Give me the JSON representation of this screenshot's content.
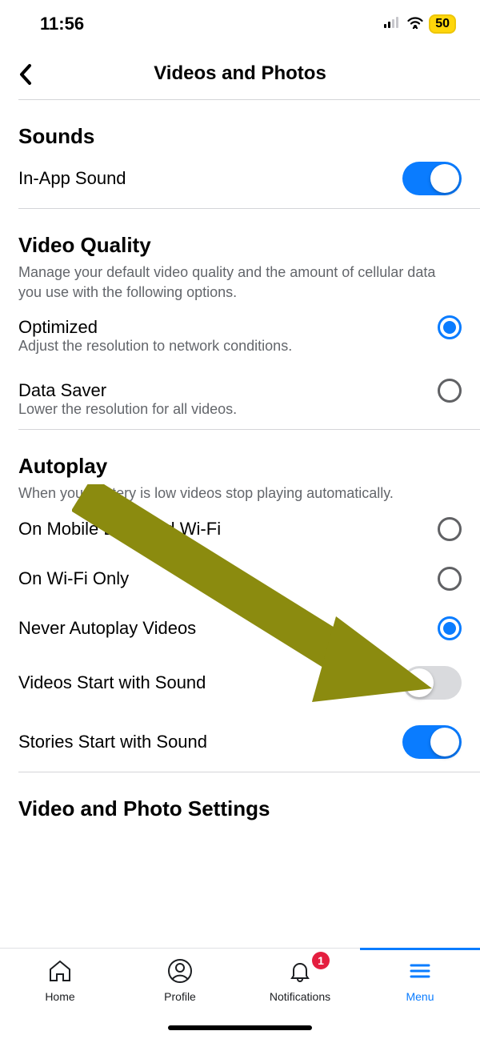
{
  "status": {
    "time": "11:56",
    "battery": "50"
  },
  "header": {
    "title": "Videos and Photos"
  },
  "sounds": {
    "title": "Sounds",
    "in_app_sound": {
      "label": "In-App Sound",
      "on": true
    }
  },
  "video_quality": {
    "title": "Video Quality",
    "subhead": "Manage your default video quality and the amount of cellular data you use with the following options.",
    "optimized": {
      "label": "Optimized",
      "desc": "Adjust the resolution to network conditions.",
      "selected": true
    },
    "data_saver": {
      "label": "Data Saver",
      "desc": "Lower the resolution for all videos.",
      "selected": false
    }
  },
  "autoplay": {
    "title": "Autoplay",
    "subhead": "When your battery is low videos stop playing automatically.",
    "options": {
      "mobile_wifi": {
        "label": "On Mobile Data and Wi-Fi",
        "selected": false
      },
      "wifi_only": {
        "label": "On Wi-Fi Only",
        "selected": false
      },
      "never": {
        "label": "Never Autoplay Videos",
        "selected": true
      }
    },
    "videos_start_sound": {
      "label": "Videos Start with Sound",
      "on": false
    },
    "stories_start_sound": {
      "label": "Stories Start with Sound",
      "on": true
    }
  },
  "vp_settings": {
    "title": "Video and Photo Settings"
  },
  "tabs": {
    "home": "Home",
    "profile": "Profile",
    "notifications": "Notifications",
    "menu": "Menu",
    "badge": "1",
    "active": "menu"
  },
  "annotation": {
    "type": "arrow",
    "color": "#8b8b0f"
  }
}
